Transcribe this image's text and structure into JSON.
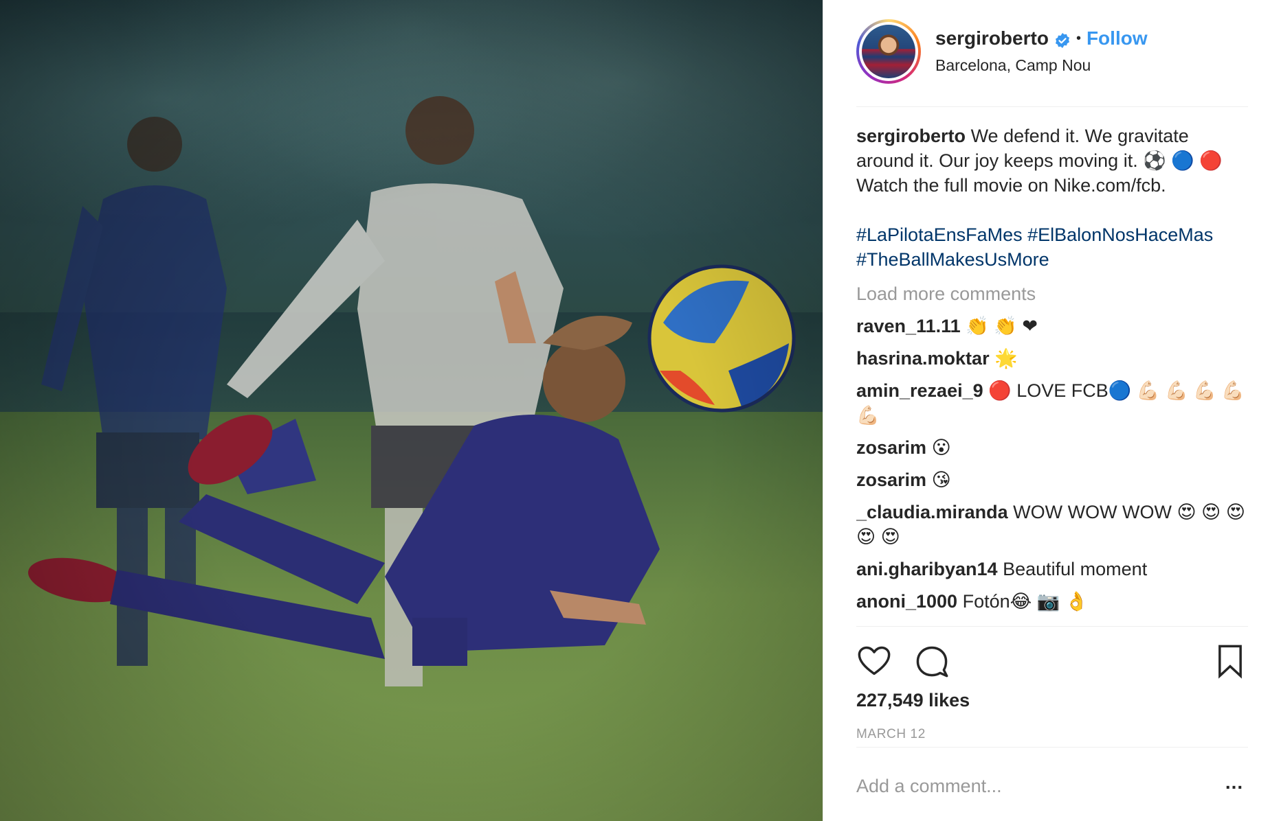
{
  "post": {
    "image_alt": "Player performing a bicycle kick on a football pitch",
    "author": {
      "username": "sergiroberto",
      "verified": true,
      "follow_label": "Follow",
      "separator": "•",
      "location": "Barcelona, Camp Nou"
    },
    "caption": {
      "username": "sergiroberto",
      "text": "We defend it. We gravitate around it. Our joy keeps moving it. ⚽ 🔵 🔴 Watch the full movie on Nike.com/fcb.",
      "hashtags": "#LaPilotaEnsFaMes #ElBalonNosHaceMas #TheBallMakesUsMore"
    },
    "load_more_label": "Load more comments",
    "comments": [
      {
        "user": "raven_11.11",
        "text": "👏 👏 ❤"
      },
      {
        "user": "hasrina.moktar",
        "text": "🌟"
      },
      {
        "user": "amin_rezaei_9",
        "text": "🔴 LOVE FCB🔵 💪🏻 💪🏻 💪🏻 💪🏻 💪🏻"
      },
      {
        "user": "zosarim",
        "text": "😮"
      },
      {
        "user": "zosarim",
        "text": "😘"
      },
      {
        "user": "_claudia.miranda",
        "text": "WOW WOW WOW 😍 😍 😍 😍 😍"
      },
      {
        "user": "ani.gharibyan14",
        "text": "Beautiful moment"
      },
      {
        "user": "anoni_1000",
        "text": "Fotón😂 📷 👌"
      }
    ],
    "likes_label": "227,549 likes",
    "date_label": "MARCH 12",
    "add_comment_placeholder": "Add a comment...",
    "more_options_label": "..."
  },
  "icons": {
    "like": "heart-icon",
    "comment": "comment-bubble-icon",
    "save": "bookmark-icon",
    "verified": "verified-badge-icon",
    "more": "more-options-icon"
  },
  "colors": {
    "link_blue": "#3897f0",
    "hashtag_blue": "#003569",
    "muted_gray": "#999999",
    "text_dark": "#262626",
    "divider": "#efefef"
  }
}
